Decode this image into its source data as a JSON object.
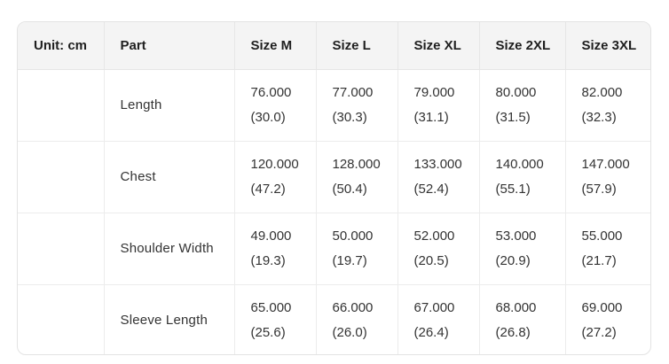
{
  "table": {
    "headers": [
      "Unit: cm",
      "Part",
      "Size M",
      "Size L",
      "Size XL",
      "Size 2XL",
      "Size 3XL"
    ],
    "rows": [
      {
        "unit": "",
        "part": "Length",
        "values": [
          {
            "cm": "76.000",
            "in": "(30.0)"
          },
          {
            "cm": "77.000",
            "in": "(30.3)"
          },
          {
            "cm": "79.000",
            "in": "(31.1)"
          },
          {
            "cm": "80.000",
            "in": "(31.5)"
          },
          {
            "cm": "82.000",
            "in": "(32.3)"
          }
        ]
      },
      {
        "unit": "",
        "part": "Chest",
        "values": [
          {
            "cm": "120.000",
            "in": "(47.2)"
          },
          {
            "cm": "128.000",
            "in": "(50.4)"
          },
          {
            "cm": "133.000",
            "in": "(52.4)"
          },
          {
            "cm": "140.000",
            "in": "(55.1)"
          },
          {
            "cm": "147.000",
            "in": "(57.9)"
          }
        ]
      },
      {
        "unit": "",
        "part": "Shoulder Width",
        "values": [
          {
            "cm": "49.000",
            "in": "(19.3)"
          },
          {
            "cm": "50.000",
            "in": "(19.7)"
          },
          {
            "cm": "52.000",
            "in": "(20.5)"
          },
          {
            "cm": "53.000",
            "in": "(20.9)"
          },
          {
            "cm": "55.000",
            "in": "(21.7)"
          }
        ]
      },
      {
        "unit": "",
        "part": "Sleeve Length",
        "values": [
          {
            "cm": "65.000",
            "in": "(25.6)"
          },
          {
            "cm": "66.000",
            "in": "(26.0)"
          },
          {
            "cm": "67.000",
            "in": "(26.4)"
          },
          {
            "cm": "68.000",
            "in": "(26.8)"
          },
          {
            "cm": "69.000",
            "in": "(27.2)"
          }
        ]
      }
    ]
  }
}
